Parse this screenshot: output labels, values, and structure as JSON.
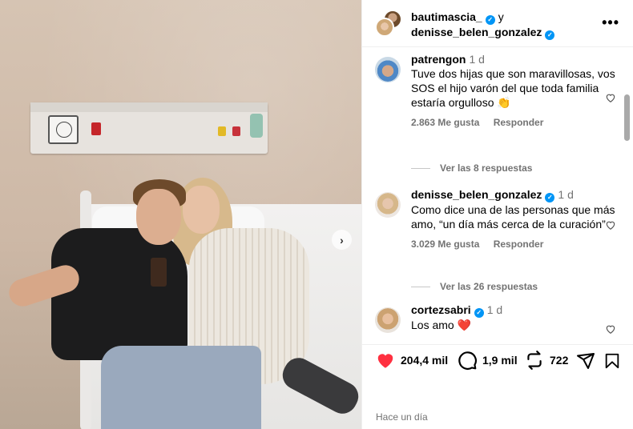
{
  "post": {
    "authors": [
      "bautimascia_",
      "denisse_belen_gonzalez"
    ],
    "and_word": "y",
    "more_label": "•••"
  },
  "comments": [
    {
      "user": "patrengon",
      "time": "1 d",
      "text": "Tuve dos hijas que son maravillosas, vos SOS el hijo varón del que toda familia estaría orgulloso 👏",
      "likes": "2.863 Me gusta",
      "reply_label": "Responder",
      "view_replies": "Ver las 8 respuestas"
    },
    {
      "user": "denisse_belen_gonzalez",
      "time": "1 d",
      "text": "Como dice una de las personas que más amo, “un día más cerca de la curación”",
      "likes": "3.029 Me gusta",
      "reply_label": "Responder",
      "view_replies": "Ver las 26 respuestas"
    },
    {
      "user": "cortezsabri",
      "time": "1 d",
      "text": "Los amo ❤️"
    }
  ],
  "actions": {
    "likes": "204,4 mil",
    "comments": "1,9 mil",
    "reposts": "722"
  },
  "date": "Hace un día",
  "colors": {
    "like_red": "#ff3040",
    "verified_blue": "#0095f6"
  },
  "icons": [
    "verified-badge-icon",
    "heart-icon",
    "comment-icon",
    "repost-icon",
    "share-icon",
    "save-icon",
    "chevron-right-icon"
  ]
}
